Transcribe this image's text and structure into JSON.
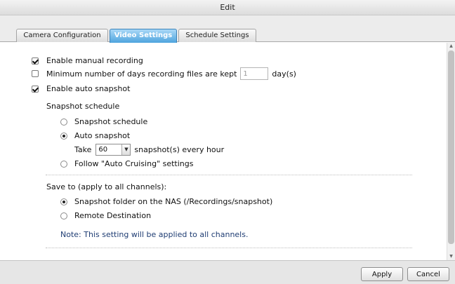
{
  "window": {
    "title": "Edit"
  },
  "tabs": [
    {
      "label": "Camera Configuration",
      "active": false
    },
    {
      "label": "Video Settings",
      "active": true
    },
    {
      "label": "Schedule Settings",
      "active": false
    }
  ],
  "options": {
    "manual_recording": {
      "label": "Enable manual recording",
      "checked": true
    },
    "min_days": {
      "label": "Minimum number of days recording files are kept",
      "checked": false,
      "value": "1",
      "unit": "day(s)"
    },
    "auto_snapshot": {
      "label": "Enable auto snapshot",
      "checked": true
    }
  },
  "snapshot_schedule": {
    "title": "Snapshot schedule",
    "radio_schedule": "Snapshot schedule",
    "radio_auto": "Auto snapshot",
    "take_prefix": "Take",
    "take_value": "60",
    "take_suffix": "snapshot(s) every hour",
    "radio_cruising": "Follow \"Auto Cruising\" settings",
    "selected": "auto"
  },
  "save_to": {
    "title": "Save to (apply to all channels):",
    "radio_nas": "Snapshot folder on the NAS (/Recordings/snapshot)",
    "radio_remote": "Remote Destination",
    "selected": "nas",
    "note": "Note: This setting will be applied to all channels."
  },
  "footer": {
    "apply_label": "Apply",
    "cancel_label": "Cancel"
  },
  "colors": {
    "active_tab": "#4fa4de",
    "note_text": "#1f3d73"
  }
}
